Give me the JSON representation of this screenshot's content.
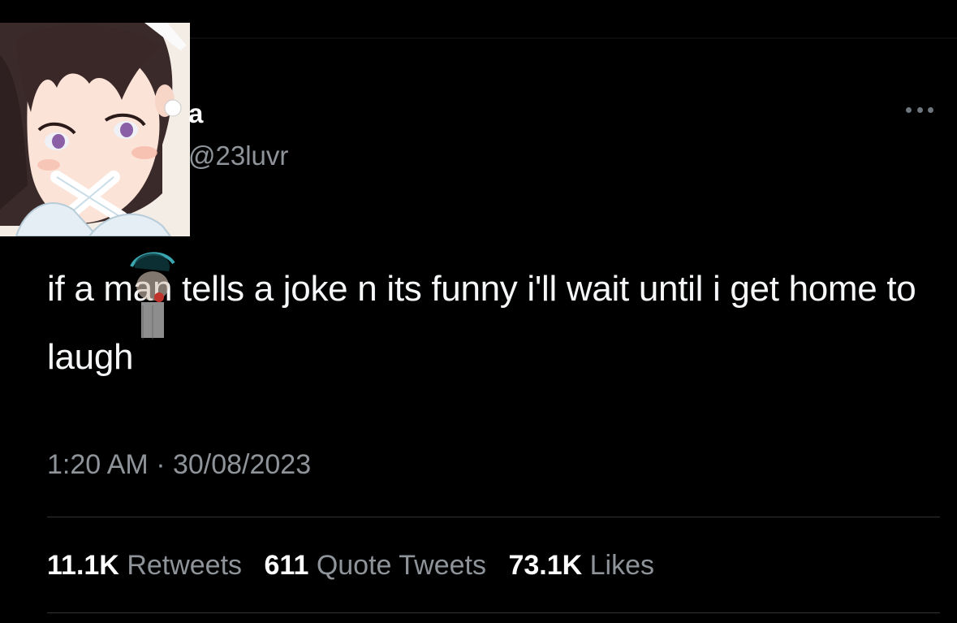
{
  "user": {
    "display_name": "a",
    "handle": "@23luvr"
  },
  "tweet": {
    "text": "if a man tells a joke n its funny i'll wait until i get home to laugh",
    "timestamp": "1:20 AM · 30/08/2023"
  },
  "stats": [
    {
      "count": "11.1K",
      "label": "Retweets"
    },
    {
      "count": "611",
      "label": "Quote Tweets"
    },
    {
      "count": "73.1K",
      "label": "Likes"
    }
  ],
  "icons": {
    "more": "more-options-icon",
    "avatar": "anime-girl-avatar",
    "sticker": "doodle-sticker"
  },
  "colors": {
    "background": "#000000",
    "primary_text": "#ffffff",
    "secondary_text": "#8e9499",
    "divider": "#2f3336"
  }
}
